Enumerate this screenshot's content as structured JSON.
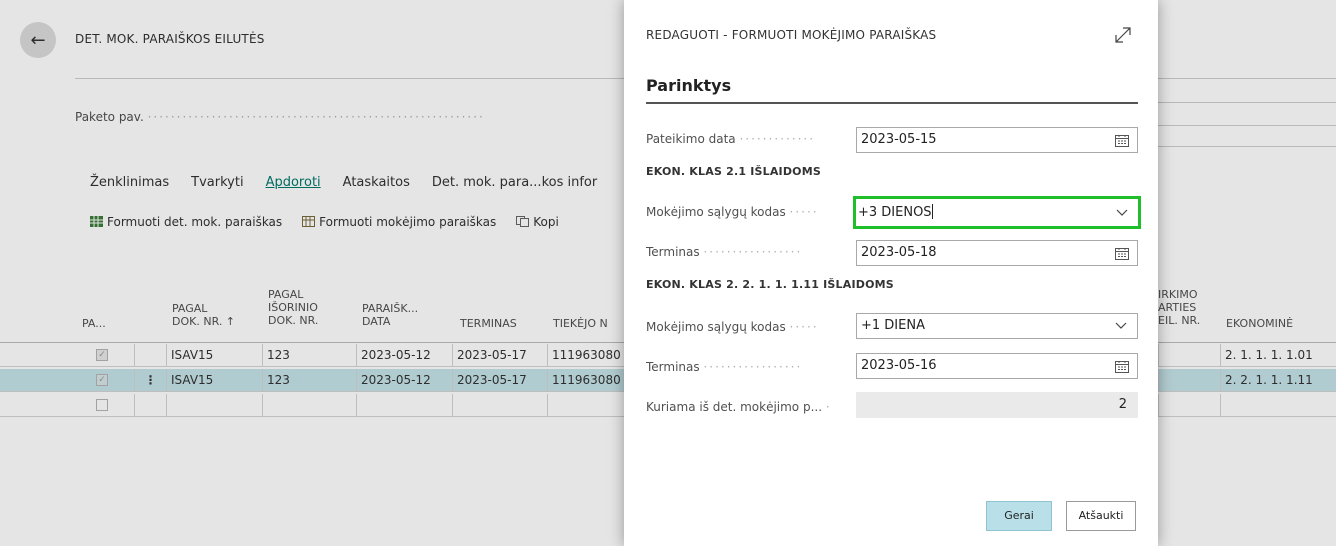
{
  "page": {
    "title": "DET. MOK. PARAIŠKOS EILUTĖS",
    "field_label": "Paketo pav.",
    "menu": [
      "Ženklinimas",
      "Tvarkyti",
      "Apdoroti",
      "Ataskaitos",
      "Det. mok. para...kos infor"
    ],
    "actions": [
      "Formuoti det. mok. paraiškas",
      "Formuoti mokėjimo paraiškas",
      "Kopi"
    ]
  },
  "table": {
    "headers": {
      "pa": "PA...",
      "pagal": "PAGAL\nDOK. NR. ↑",
      "isorinio": "PAGAL\nIŠORINIO\nDOK. NR.",
      "paraisk": "PARAIŠK...\nDATA",
      "terminas": "TERMINAS",
      "tiekejo": "TIEKĖJO N",
      "pirkimo": "IRKIMO\nARTIES\nEIL. NR.",
      "ekonomine": "EKONOMINĖ"
    },
    "rows": [
      {
        "dok": "ISAV15",
        "isor": "123",
        "data": "2023-05-12",
        "term": "2023-05-17",
        "tiek": "111963080",
        "ekon": "2. 1. 1. 1. 1.01"
      },
      {
        "dok": "ISAV15",
        "isor": "123",
        "data": "2023-05-12",
        "term": "2023-05-17",
        "tiek": "111963080",
        "ekon": "2. 2. 1. 1. 1.11"
      }
    ]
  },
  "dialog": {
    "title": "REDAGUOTI - FORMUOTI MOKĖJIMO PARAIŠKAS",
    "section": "Parinktys",
    "pateikimo_label": "Pateikimo data",
    "pateikimo_value": "2023-05-15",
    "group1": "EKON. KLAS 2.1 IŠLAIDOMS",
    "salygu1_label": "Mokėjimo sąlygų kodas",
    "salygu1_value": "+3 DIENOS",
    "terminas1_label": "Terminas",
    "terminas1_value": "2023-05-18",
    "group2": "EKON. KLAS 2. 2. 1. 1. 1.11 IŠLAIDOMS",
    "salygu2_label": "Mokėjimo sąlygų kodas",
    "salygu2_value": "+1 DIENA",
    "terminas2_label": "Terminas",
    "terminas2_value": "2023-05-16",
    "kuriama_label": "Kuriama iš det. mokėjimo p...",
    "kuriama_value": "2",
    "ok_label": "Gerai",
    "cancel_label": "Atšaukti"
  },
  "colors": {
    "focus_border": "#1fbf2b",
    "selected_row": "#c6e4e8",
    "primary_button": "#b9dfe9",
    "link_active": "#00796b"
  }
}
